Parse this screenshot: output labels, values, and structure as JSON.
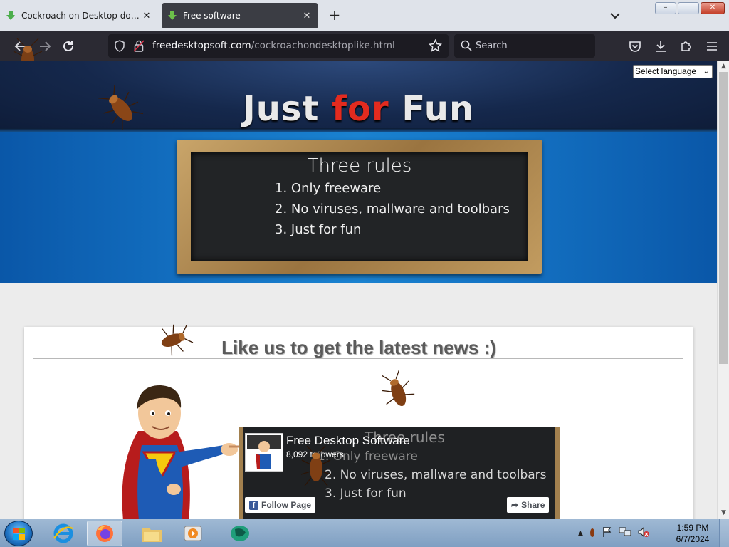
{
  "tabs": [
    {
      "title": "Cockroach on Desktop download",
      "active": false
    },
    {
      "title": "Free software",
      "active": true
    }
  ],
  "window_buttons": {
    "minimize": "–",
    "restore": "❐",
    "close": "✕"
  },
  "url": {
    "domain": "freedesktopsoft.com",
    "path": "/cockroachondesktoplike.html"
  },
  "search": {
    "placeholder": "Search"
  },
  "language_select": {
    "selected": "Select language"
  },
  "hero": {
    "title_part1": "Just ",
    "title_part2": "for",
    "title_part3": " Fun"
  },
  "board": {
    "title": "Three rules",
    "rules": [
      "1. Only freeware",
      "2. No viruses, mallware and toolbars",
      "3. Just for fun"
    ]
  },
  "card": {
    "heading": "Like us to get the latest news :)"
  },
  "facebook": {
    "page_name": "Free Desktop Software",
    "followers": "8,092 followers",
    "follow_label": "Follow Page",
    "share_label": "Share"
  },
  "clock": {
    "time": "1:59 PM",
    "date": "6/7/2024"
  },
  "colors": {
    "accent_red": "#e32b1f",
    "browser_dark": "#2b2a33",
    "fb_blue": "#3b5998"
  }
}
